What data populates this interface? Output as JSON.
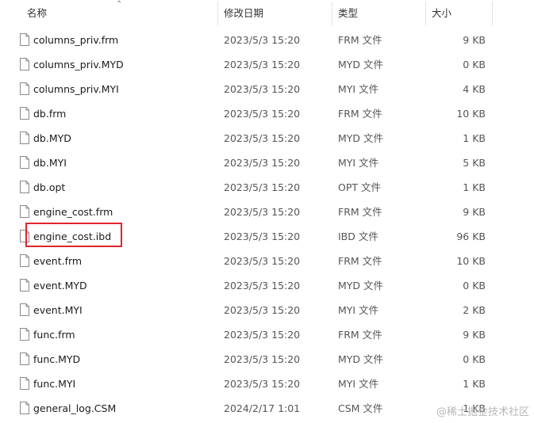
{
  "columns": {
    "name": "名称",
    "date": "修改日期",
    "type": "类型",
    "size": "大小"
  },
  "files": [
    {
      "name": "columns_priv.frm",
      "date": "2023/5/3 15:20",
      "type": "FRM 文件",
      "size": "9 KB"
    },
    {
      "name": "columns_priv.MYD",
      "date": "2023/5/3 15:20",
      "type": "MYD 文件",
      "size": "0 KB"
    },
    {
      "name": "columns_priv.MYI",
      "date": "2023/5/3 15:20",
      "type": "MYI 文件",
      "size": "4 KB"
    },
    {
      "name": "db.frm",
      "date": "2023/5/3 15:20",
      "type": "FRM 文件",
      "size": "10 KB"
    },
    {
      "name": "db.MYD",
      "date": "2023/5/3 15:20",
      "type": "MYD 文件",
      "size": "1 KB"
    },
    {
      "name": "db.MYI",
      "date": "2023/5/3 15:20",
      "type": "MYI 文件",
      "size": "5 KB"
    },
    {
      "name": "db.opt",
      "date": "2023/5/3 15:20",
      "type": "OPT 文件",
      "size": "1 KB"
    },
    {
      "name": "engine_cost.frm",
      "date": "2023/5/3 15:20",
      "type": "FRM 文件",
      "size": "9 KB"
    },
    {
      "name": "engine_cost.ibd",
      "date": "2023/5/3 15:20",
      "type": "IBD 文件",
      "size": "96 KB",
      "highlighted": true
    },
    {
      "name": "event.frm",
      "date": "2023/5/3 15:20",
      "type": "FRM 文件",
      "size": "10 KB"
    },
    {
      "name": "event.MYD",
      "date": "2023/5/3 15:20",
      "type": "MYD 文件",
      "size": "0 KB"
    },
    {
      "name": "event.MYI",
      "date": "2023/5/3 15:20",
      "type": "MYI 文件",
      "size": "2 KB"
    },
    {
      "name": "func.frm",
      "date": "2023/5/3 15:20",
      "type": "FRM 文件",
      "size": "9 KB"
    },
    {
      "name": "func.MYD",
      "date": "2023/5/3 15:20",
      "type": "MYD 文件",
      "size": "0 KB"
    },
    {
      "name": "func.MYI",
      "date": "2023/5/3 15:20",
      "type": "MYI 文件",
      "size": "1 KB"
    },
    {
      "name": "general_log.CSM",
      "date": "2024/2/17 1:01",
      "type": "CSM 文件",
      "size": "1 KB"
    }
  ],
  "watermark": "@稀土掘金技术社区",
  "colors": {
    "highlight_border": "#e0242b",
    "icon_stroke": "#8a8a8a"
  }
}
